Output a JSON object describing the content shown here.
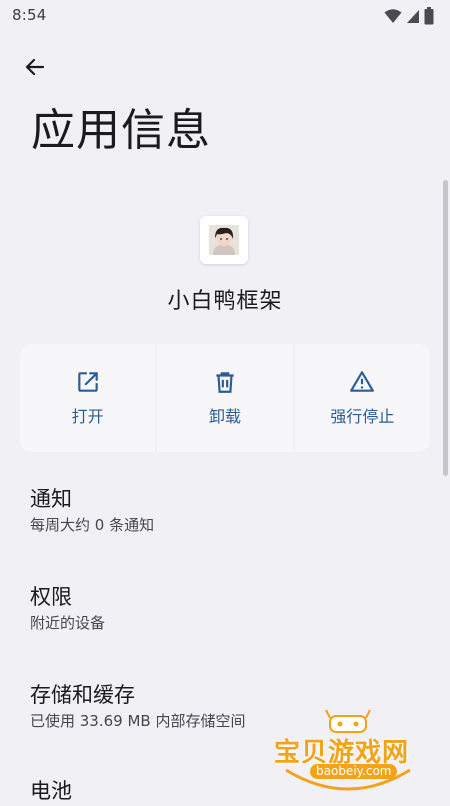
{
  "status_bar": {
    "time": "8:54",
    "icons": [
      "wifi-icon",
      "signal-icon",
      "battery-icon"
    ]
  },
  "header": {
    "back_icon": "arrow-back-icon",
    "title": "应用信息"
  },
  "app": {
    "name": "小白鸭框架",
    "icon": "app-avatar-icon"
  },
  "actions": [
    {
      "label": "打开",
      "icon": "open-external-icon"
    },
    {
      "label": "卸载",
      "icon": "trash-icon"
    },
    {
      "label": "强行停止",
      "icon": "warning-icon"
    }
  ],
  "settings": [
    {
      "title": "通知",
      "summary": "每周大约 0 条通知"
    },
    {
      "title": "权限",
      "summary": "附近的设备"
    },
    {
      "title": "存储和缓存",
      "summary": "已使用 33.69 MB 内部存储空间"
    },
    {
      "title": "电池",
      "summary": ""
    }
  ],
  "watermark": {
    "text": "宝贝游戏网",
    "url": "baobeiy.com"
  },
  "colors": {
    "background": "#f1f0f5",
    "accent": "#2c5d92",
    "watermark": "#f2a31a"
  }
}
